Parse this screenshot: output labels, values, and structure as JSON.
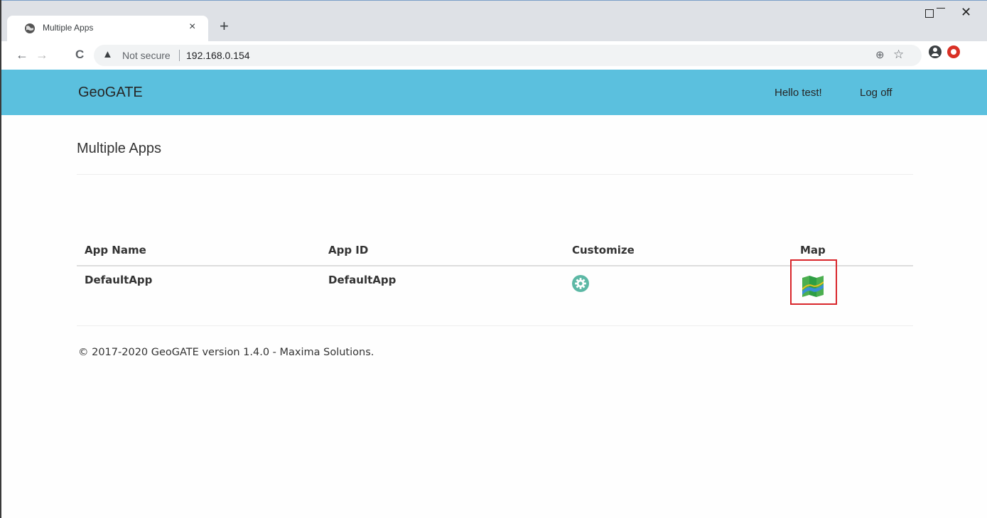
{
  "browser": {
    "tab_title": "Multiple Apps",
    "tab_close": "×",
    "new_tab": "+",
    "window_close": "✕",
    "nav_back": "←",
    "nav_forward": "→",
    "reload": "C",
    "security_warning_icon": "▲",
    "security_label": "Not secure",
    "url": "192.168.0.154",
    "zoom_icon": "⊕",
    "star_icon": "☆"
  },
  "navbar": {
    "brand": "GeoGATE",
    "greeting": "Hello test!",
    "logoff": "Log off",
    "color": "#5bc0de"
  },
  "page": {
    "title": "Multiple Apps"
  },
  "table": {
    "headers": {
      "app_name": "App Name",
      "app_id": "App ID",
      "customize": "Customize",
      "map": "Map"
    },
    "rows": [
      {
        "app_name": "DefaultApp",
        "app_id": "DefaultApp",
        "customize_icon": "gear-icon",
        "map_icon": "map-icon"
      }
    ]
  },
  "highlight_color": "#d9262b",
  "footer": {
    "text": "© 2017-2020 GeoGATE version 1.4.0 - Maxima Solutions."
  }
}
